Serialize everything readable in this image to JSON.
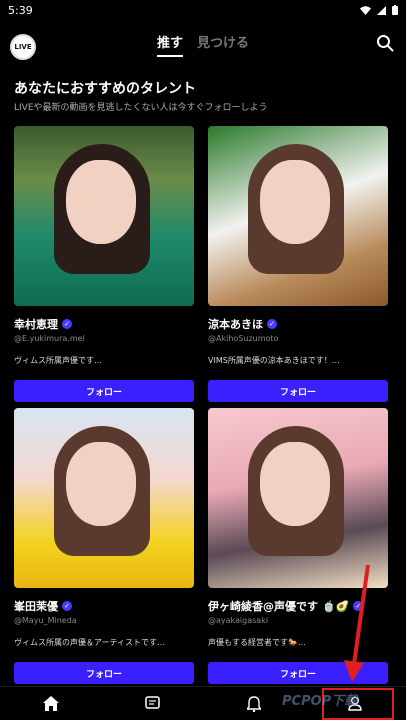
{
  "status": {
    "time": "5:39"
  },
  "header": {
    "logo_text": "LIVE",
    "tabs": [
      {
        "label": "推す",
        "active": true
      },
      {
        "label": "見つける",
        "active": false
      }
    ]
  },
  "section": {
    "title": "あなたにおすすめのタレント",
    "subtitle": "LIVEや最新の動画を見逃したくない人は今すぐフォローしよう"
  },
  "talents": [
    {
      "name": "幸村恵理",
      "handle": "@E.yukimura.mel",
      "bio": "ヴィムス所属声優です…",
      "follow_label": "フォロー"
    },
    {
      "name": "涼本あきほ",
      "handle": "@AkihoSuzumoto",
      "bio": "VIMS所属声優の涼本あきほです！…",
      "follow_label": "フォロー"
    },
    {
      "name": "峯田茉優",
      "handle": "@Mayu_Mineda",
      "bio": "ヴィムス所属の声優＆アーティストです…",
      "follow_label": "フォロー"
    },
    {
      "name": "伊ヶ崎綾香@声優です",
      "name_emoji": "🍵🥑",
      "handle": "@ayakaigasaki",
      "bio": "声優もする経営者です🐎…",
      "follow_label": "フォロー"
    }
  ],
  "nav": [
    {
      "icon": "home-icon",
      "label": ""
    },
    {
      "icon": "chat-icon",
      "label": ""
    },
    {
      "icon": "bell-icon",
      "label": ""
    },
    {
      "icon": "profile-icon",
      "label": ""
    }
  ],
  "watermark": "PCPOP下载",
  "colors": {
    "accent": "#3a20ff",
    "verify": "#4a3cff",
    "annotation": "#e02020"
  }
}
